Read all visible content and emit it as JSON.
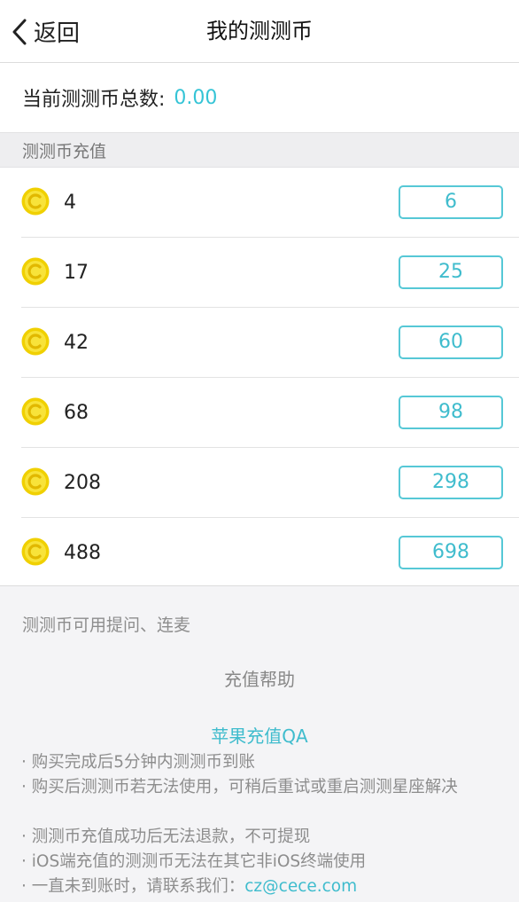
{
  "nav": {
    "back_label": "返回",
    "title": "我的测测币"
  },
  "balance": {
    "label": "当前测测币总数:",
    "value": "0.00"
  },
  "section": {
    "title": "测测币充值"
  },
  "packages": [
    {
      "coins": "4",
      "price": "6"
    },
    {
      "coins": "17",
      "price": "25"
    },
    {
      "coins": "42",
      "price": "60"
    },
    {
      "coins": "68",
      "price": "98"
    },
    {
      "coins": "208",
      "price": "298"
    },
    {
      "coins": "488",
      "price": "698"
    }
  ],
  "note": "测测币可用提问、连麦",
  "help": {
    "title": "充值帮助",
    "qa_title": "苹果充值QA",
    "items": [
      "· 购买完成后5分钟内测测币到账",
      "· 购买后测测币若无法使用，可稍后重试或重启测测星座解决",
      "· 测测币充值成功后无法退款，不可提现",
      "· iOS端充值的测测币无法在其它非iOS终端使用",
      "· 一直未到账时，请联系我们："
    ],
    "email": "cz@cece.com"
  },
  "colors": {
    "accent": "#3fbccd",
    "coin": "#f5d90a"
  },
  "icons": {
    "back": "chevron-left-icon",
    "coin": "coin-icon"
  }
}
